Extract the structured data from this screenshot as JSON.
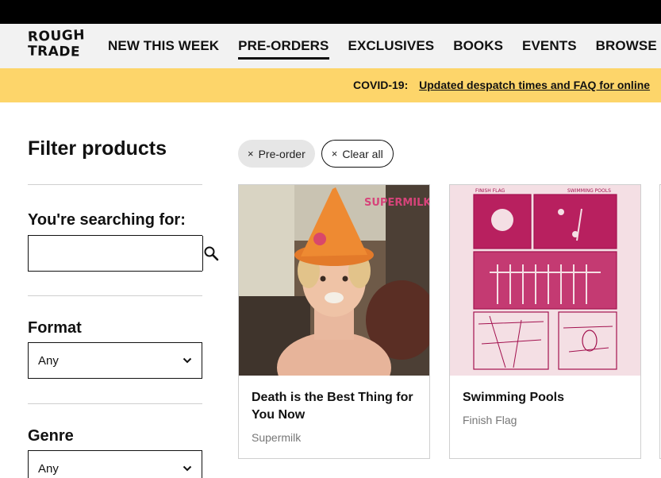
{
  "logo": {
    "line1": "ROUGH",
    "line2": "TRADE"
  },
  "nav": {
    "items": [
      {
        "label": "NEW THIS WEEK"
      },
      {
        "label": "PRE-ORDERS"
      },
      {
        "label": "EXCLUSIVES"
      },
      {
        "label": "BOOKS"
      },
      {
        "label": "EVENTS"
      },
      {
        "label": "BROWSE"
      }
    ]
  },
  "banner": {
    "label": "COVID-19:",
    "link": "Updated despatch times and FAQ for online"
  },
  "sidebar": {
    "title": "Filter products",
    "search_label": "You're searching for:",
    "search_value": "",
    "format_label": "Format",
    "format_value": "Any",
    "genre_label": "Genre",
    "genre_value": "Any"
  },
  "chips": {
    "preorder": "Pre-order",
    "clear": "Clear all",
    "remove_glyph": "×"
  },
  "products": [
    {
      "title": "Death is the Best Thing for You Now",
      "artist": "Supermilk",
      "art_text": "SUPERMILK"
    },
    {
      "title": "Swimming Pools",
      "artist": "Finish Flag",
      "art_text_left": "FINISH FLAG",
      "art_text_right": "SWIMMING POOLS"
    }
  ],
  "colors": {
    "banner": "#fdd56a",
    "nav_bg": "#f2f2f2",
    "topbar": "#000000",
    "art_magenta": "#a3124f"
  }
}
